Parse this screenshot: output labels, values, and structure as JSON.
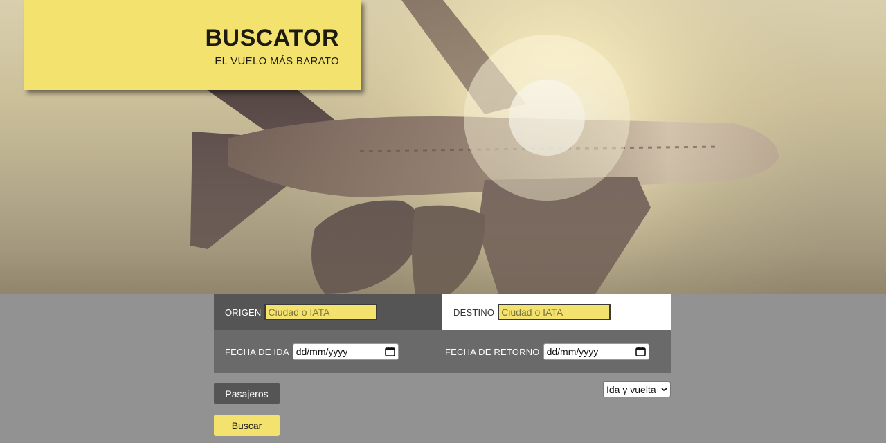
{
  "brand": {
    "title": "BUSCATOR",
    "subtitle": "EL VUELO MÁS BARATO"
  },
  "form": {
    "origin": {
      "label": "ORIGEN",
      "placeholder": "Ciudad o IATA",
      "value": ""
    },
    "destination": {
      "label": "DESTINO",
      "placeholder": "Ciudad o IATA",
      "value": ""
    },
    "departure": {
      "label": "FECHA DE IDA",
      "value": "dd/mm/yyyy",
      "icon": "calendar-icon"
    },
    "return": {
      "label": "FECHA DE RETORNO",
      "value": "dd/mm/yyyy",
      "icon": "calendar-icon"
    },
    "passengers_button": "Pasajeros",
    "trip_type": {
      "selected": "Ida y vuelta",
      "icon": "chevron-down-icon"
    },
    "search_button": "Buscar"
  },
  "colors": {
    "accent_yellow": "#f3e36e",
    "dark_gray": "#555555",
    "mid_gray": "#6a6a6a",
    "page_gray": "#929292"
  }
}
